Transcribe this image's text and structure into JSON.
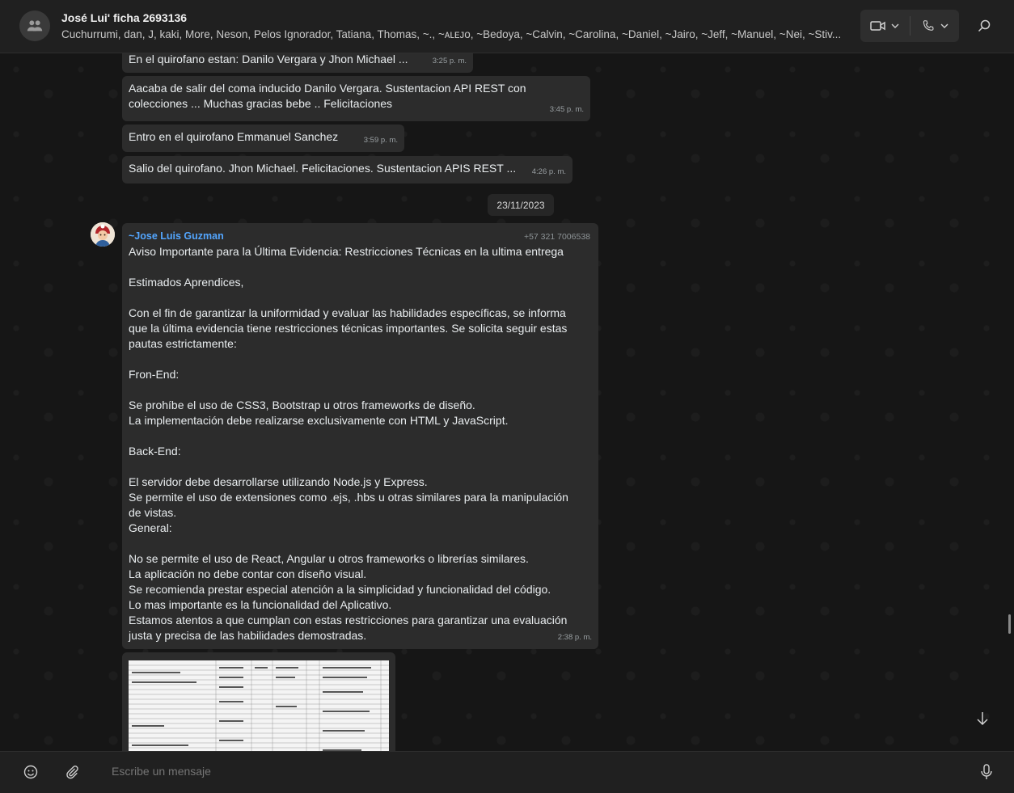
{
  "header": {
    "title": "José Lui' ficha 2693136",
    "participants": "Cuchurrumi, dan, J, kaki, More, Neson, Pelos Ignorador, Tatiana, Thomas, ~., ~ᴀʟᴇᴊᴏ, ~Bedoya, ~Calvin, ~Carolina, ~Daniel, ~Jairo, ~Jeff, ~Manuel, ~Nei, ~Stiv..."
  },
  "messages": [
    {
      "text": "En el quirofano estan: Danilo Vergara y Jhon Michael ...",
      "time": "3:25 p. m."
    },
    {
      "text": "Aacaba de salir del coma inducido Danilo Vergara. Sustentacion API REST con colecciones ... Muchas gracias bebe .. Felicitaciones",
      "time": "3:45 p. m."
    },
    {
      "text": "Entro en el quirofano Emmanuel Sanchez",
      "time": "3:59 p. m."
    },
    {
      "text": "Salio del quirofano. Jhon Michael. Felicitaciones. Sustentacion APIS REST ...",
      "time": "4:26 p. m."
    }
  ],
  "date_separator": "23/11/2023",
  "long_message": {
    "sender": "~Jose Luis Guzman",
    "phone": "+57 321 7006538",
    "text": "Aviso Importante para la Última Evidencia: Restricciones Técnicas en la ultima entrega\n\nEstimados Aprendices,\n\nCon el fin de garantizar la uniformidad y evaluar las habilidades específicas, se informa que la última evidencia tiene restricciones técnicas importantes. Se solicita seguir estas pautas estrictamente:\n\nFron-End:\n\nSe prohíbe el uso de CSS3, Bootstrap u otros frameworks de diseño.\nLa implementación debe realizarse exclusivamente con HTML y JavaScript.\n\nBack-End:\n\nEl servidor debe desarrollarse utilizando Node.js y Express.\nSe permite el uso de extensiones como .ejs, .hbs u otras similares para la manipulación de vistas.\nGeneral:\n\nNo se permite el uso de React, Angular u otros frameworks o librerías similares.\nLa aplicación no debe contar con diseño visual.\nSe recomienda prestar especial atención a la simplicidad y funcionalidad del código.\nLo mas importante es la funcionalidad del Aplicativo.\nEstamos atentos a que cumplan con estas restricciones para garantizar una evaluación justa y precisa de las habilidades demostradas.",
    "time": "2:38 p. m."
  },
  "composer": {
    "placeholder": "Escribe un mensaje"
  },
  "icons": {
    "group_avatar": "group-icon",
    "video": "video-camera-icon",
    "phone": "phone-icon",
    "search": "search-icon",
    "emoji": "emoji-icon",
    "attach": "paperclip-icon",
    "mic": "microphone-icon",
    "scroll_down": "arrow-down-icon"
  }
}
